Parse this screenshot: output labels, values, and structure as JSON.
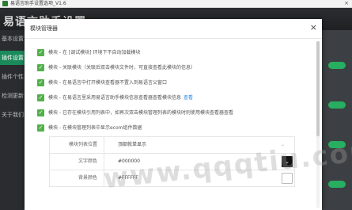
{
  "app": {
    "window_title": "易语言助手设置选项_V1.6",
    "header_title": "易语言助手设置",
    "close_glyph": "×"
  },
  "sidebar": {
    "items": [
      {
        "label": "基本设置",
        "active": false
      },
      {
        "label": "插件设置",
        "active": true
      },
      {
        "label": "插件个性",
        "active": false
      },
      {
        "label": "检测更新",
        "active": false
      },
      {
        "label": "关于我们",
        "active": false
      }
    ]
  },
  "modal": {
    "title": "模块管理器",
    "close_glyph": "×",
    "options": [
      {
        "label": "模块 - 在 [调试模块] 环境下不自动加载模块",
        "checked": true
      },
      {
        "label": "模块 - 关联模块（关联后双击模块文件时，可直接查看此模块的信息）",
        "checked": true
      },
      {
        "label": "模块 - 在易语言中打开模块查看器不置入到易语言父窗口",
        "checked": true
      },
      {
        "label": "模块 - 在易语言里采用易语言助手模块信息查看器查看模块信息",
        "checked": true,
        "link": "查看"
      },
      {
        "label": "模块 - 已存在模块引用列表中，如再次双击模块管理列表的模块时则使用模块查看器查看",
        "checked": true
      },
      {
        "label": "模块 - 在模块管理列表中显示ecom组件数据",
        "checked": true
      }
    ],
    "form": {
      "list_position_label": "模块列表位置",
      "list_position_value": "顶部就单显示",
      "text_color_label": "文字颜色",
      "text_color_value": "#000000",
      "bg_color_label": "背景颜色",
      "bg_color_value": "#FFFFFF",
      "caret": "⌄",
      "picker_glyph": "⌄"
    }
  },
  "watermark": "www.qqqtiu.com",
  "colors": {
    "accent_green": "#1b8a5a",
    "checkbox_green": "#52b04a",
    "link_blue": "#1e88e5",
    "text_color_swatch": "#000000",
    "bg_color_swatch": "#FFFFFF"
  }
}
